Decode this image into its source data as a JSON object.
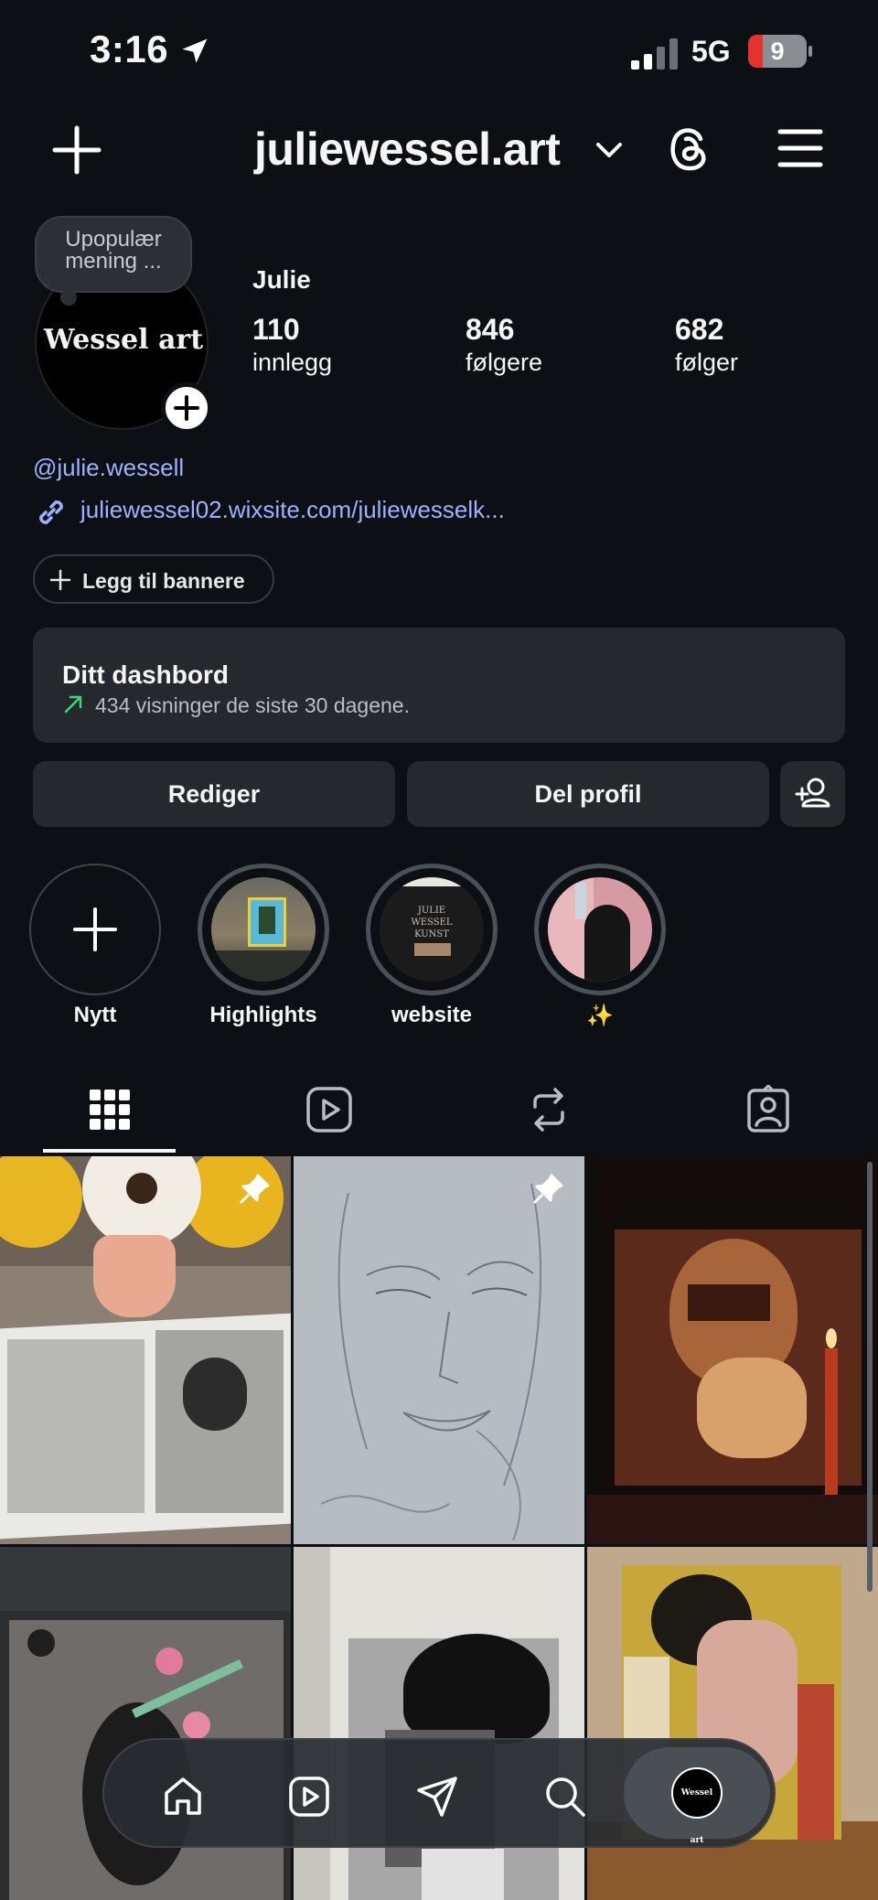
{
  "status_bar": {
    "time": "3:16",
    "network": "5G",
    "battery": "9"
  },
  "header": {
    "username": "juliewessel.art"
  },
  "profile": {
    "avatar_text": "Wessel art",
    "note": "Upopulær mening ...",
    "display_name": "Julie",
    "stats": [
      {
        "value": "110",
        "label": "innlegg"
      },
      {
        "value": "846",
        "label": "følgere"
      },
      {
        "value": "682",
        "label": "følger"
      }
    ],
    "handle": "@julie.wessell",
    "link": "juliewessel02.wixsite.com/juliewesselk..."
  },
  "banner_button": "Legg til bannere",
  "dashboard": {
    "title": "Ditt dashbord",
    "subtitle": "434 visninger de siste 30 dagene."
  },
  "actions": {
    "edit": "Rediger",
    "share": "Del profil"
  },
  "highlights": [
    {
      "label": "Nytt"
    },
    {
      "label": "Highlights"
    },
    {
      "label": "website",
      "thumb_text": "JULIE WESSEL KUNST"
    },
    {
      "label": "✨"
    }
  ],
  "tabs": [
    "grid-icon",
    "reels-icon",
    "reposts-icon",
    "tagged-icon"
  ],
  "nav": {
    "avatar_text": "Wessel art"
  },
  "colors": {
    "background": "#0c1014",
    "link": "#9db2ff",
    "card": "#25292e",
    "trend": "#3cd67a"
  }
}
